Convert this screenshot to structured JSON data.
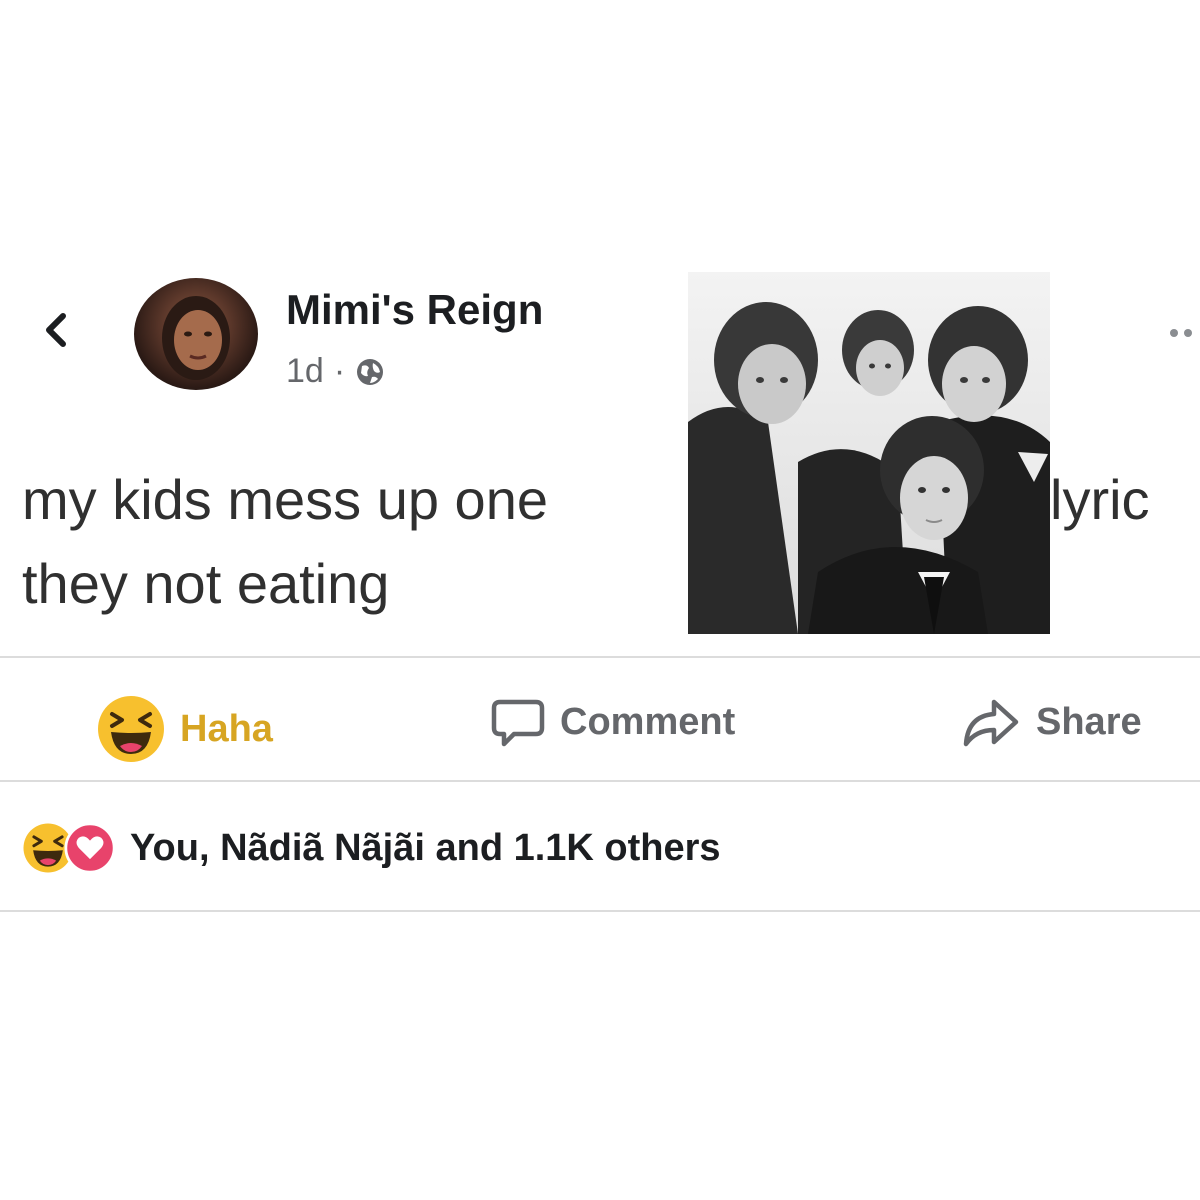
{
  "post": {
    "author_name": "Mimi's Reign",
    "timestamp": "1d",
    "meta_separator": "·",
    "privacy_icon": "globe-icon",
    "text_left_line1": "my kids mess up one",
    "text_left_line2": "they not eating",
    "text_right_line1": "lyric",
    "photo_icon": "band-photo"
  },
  "actions": {
    "haha_label": "Haha",
    "comment_label": "Comment",
    "share_label": "Share"
  },
  "reactions": {
    "summary": "You, Nãdiã Nãjãi and 1.1K others",
    "icons": [
      "haha-icon",
      "love-icon"
    ]
  },
  "colors": {
    "haha_yellow": "#f7c02e",
    "haha_label": "#d7a522",
    "love_red": "#e8436b",
    "secondary_text": "#65676b"
  }
}
